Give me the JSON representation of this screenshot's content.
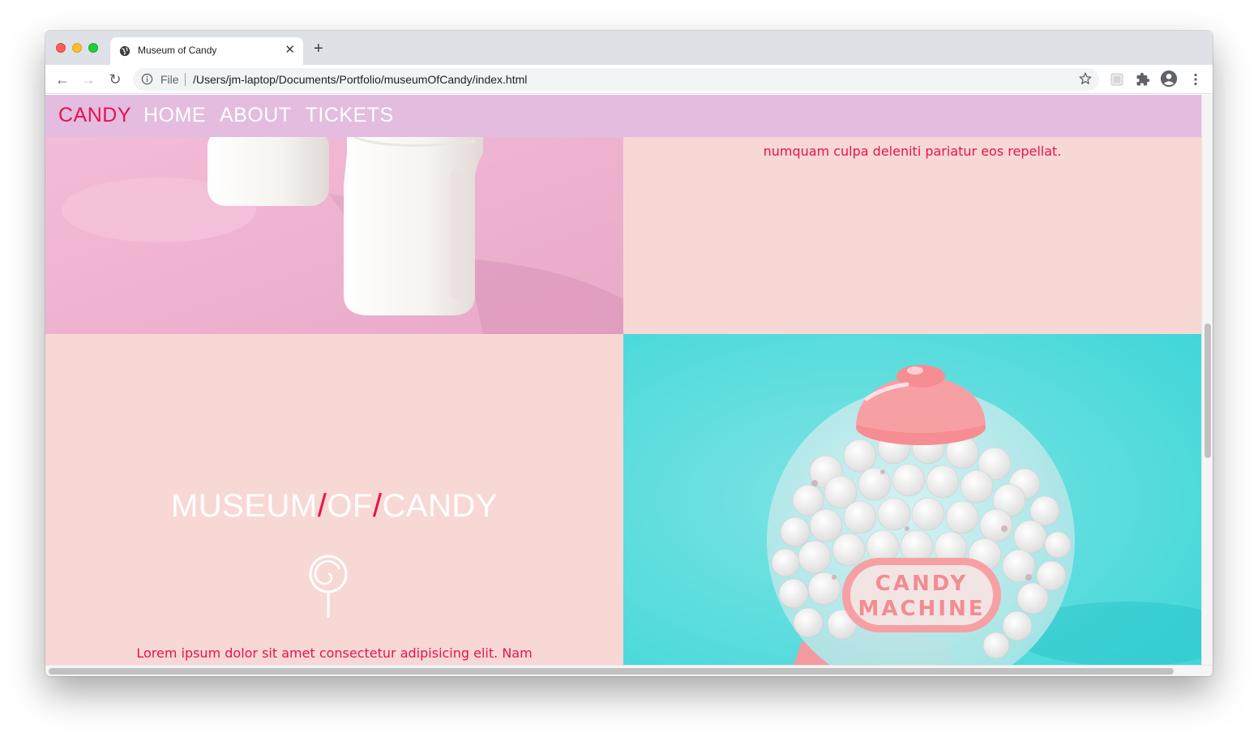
{
  "browser": {
    "tab_title": "Museum of Candy",
    "tab_close": "✕",
    "new_tab": "+",
    "url_scheme_label": "File",
    "url": "/Users/jm-laptop/Documents/Portfolio/museumOfCandy/index.html",
    "back_glyph": "←",
    "forward_glyph": "→",
    "reload_glyph": "↻"
  },
  "site": {
    "brand": "CANDY",
    "nav": [
      "HOME",
      "ABOUT",
      "TICKETS"
    ],
    "top_text": "numquam culpa deleniti pariatur eos repellat.",
    "title_parts": [
      "MUSEUM",
      "/",
      "OF",
      "/",
      "CANDY"
    ],
    "bottom_text": "Lorem ipsum dolor sit amet consectetur adipisicing elit. Nam",
    "gumball_label_line1": "CANDY",
    "gumball_label_line2": "MACHINE"
  },
  "colors": {
    "nav_bg": "#e3bce0",
    "brand_red": "#e8124e",
    "panel_pink": "#f8d8d5",
    "teal": "#5cd8da"
  },
  "icons": [
    "globe-icon",
    "info-icon",
    "star-icon",
    "extension-icon",
    "puzzle-icon",
    "profile-icon",
    "menu-icon",
    "lollipop-icon"
  ]
}
